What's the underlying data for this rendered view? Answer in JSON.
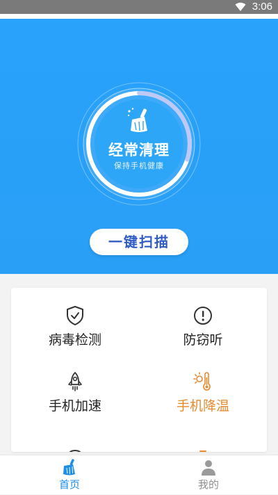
{
  "status_bar": {
    "time": "3:06"
  },
  "hero": {
    "title": "经常清理",
    "subtitle": "保持手机健康",
    "scan_button": "一键扫描",
    "ring_progress": 0.3
  },
  "features": [
    {
      "label": "病毒检测",
      "icon": "shield-check-icon",
      "color": "#222222"
    },
    {
      "label": "防窃听",
      "icon": "alert-circle-icon",
      "color": "#222222"
    },
    {
      "label": "手机加速",
      "icon": "rocket-icon",
      "color": "#222222"
    },
    {
      "label": "手机降温",
      "icon": "thermometer-sun-icon",
      "color": "#e78a2e"
    }
  ],
  "tabs": [
    {
      "label": "首页",
      "icon": "broom-icon",
      "active": true
    },
    {
      "label": "我的",
      "icon": "user-icon",
      "active": false
    }
  ],
  "colors": {
    "primary": "#28a2fb",
    "accent_orange": "#e78a2e",
    "tab_active": "#1e8ee8",
    "button_text": "#2f5cc4"
  }
}
